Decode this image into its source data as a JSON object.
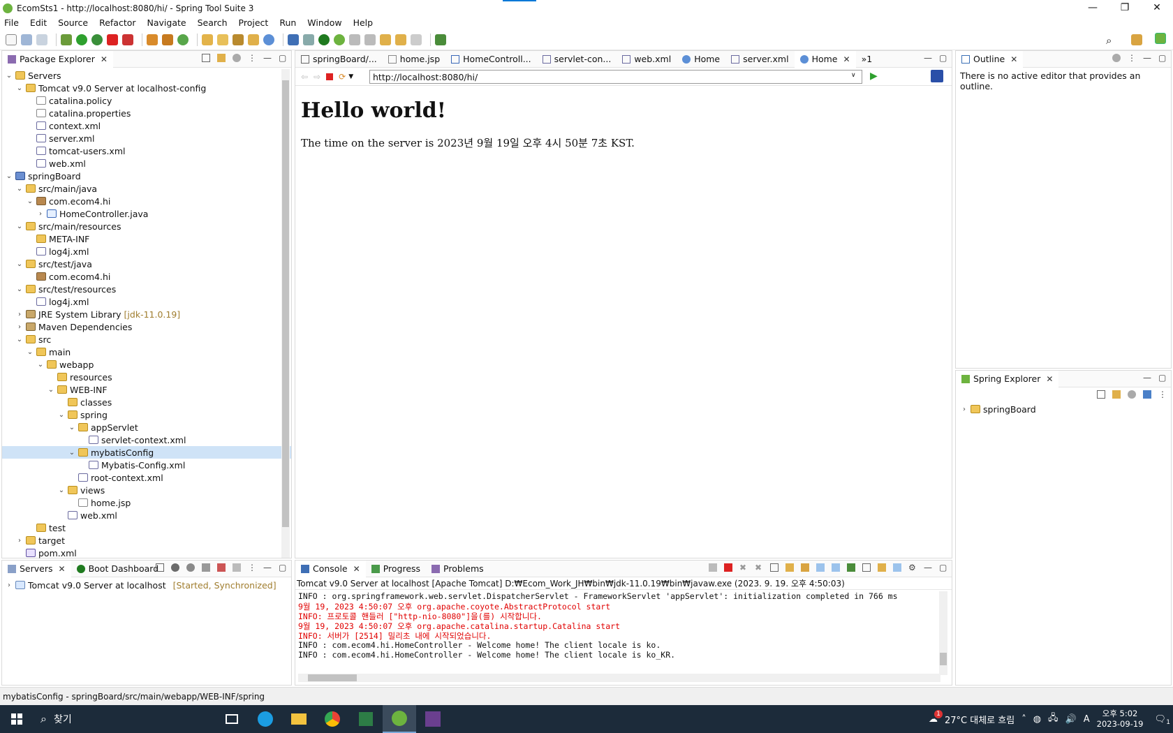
{
  "window": {
    "title": "EcomSts1 - http://localhost:8080/hi/ - Spring Tool Suite 3",
    "minimize": "—",
    "restore": "❐",
    "close": "✕"
  },
  "menu": [
    "File",
    "Edit",
    "Source",
    "Refactor",
    "Navigate",
    "Search",
    "Project",
    "Run",
    "Window",
    "Help"
  ],
  "package_explorer": {
    "tab_label": "Package Explorer",
    "tree": [
      {
        "label": "Servers",
        "indent": 0,
        "twisty": "v",
        "icon": "folder"
      },
      {
        "label": "Tomcat v9.0 Server at localhost-config",
        "indent": 1,
        "twisty": "v",
        "icon": "folder"
      },
      {
        "label": "catalina.policy",
        "indent": 2,
        "twisty": "",
        "icon": "file"
      },
      {
        "label": "catalina.properties",
        "indent": 2,
        "twisty": "",
        "icon": "file"
      },
      {
        "label": "context.xml",
        "indent": 2,
        "twisty": "",
        "icon": "xml"
      },
      {
        "label": "server.xml",
        "indent": 2,
        "twisty": "",
        "icon": "xml"
      },
      {
        "label": "tomcat-users.xml",
        "indent": 2,
        "twisty": "",
        "icon": "xml"
      },
      {
        "label": "web.xml",
        "indent": 2,
        "twisty": "",
        "icon": "xml"
      },
      {
        "label": "springBoard",
        "indent": 0,
        "twisty": "v",
        "icon": "proj"
      },
      {
        "label": "src/main/java",
        "indent": 1,
        "twisty": "v",
        "icon": "folder"
      },
      {
        "label": "com.ecom4.hi",
        "indent": 2,
        "twisty": "v",
        "icon": "pkg"
      },
      {
        "label": "HomeController.java",
        "indent": 3,
        "twisty": ">",
        "icon": "java"
      },
      {
        "label": "src/main/resources",
        "indent": 1,
        "twisty": "v",
        "icon": "folder"
      },
      {
        "label": "META-INF",
        "indent": 2,
        "twisty": "",
        "icon": "folder"
      },
      {
        "label": "log4j.xml",
        "indent": 2,
        "twisty": "",
        "icon": "xml"
      },
      {
        "label": "src/test/java",
        "indent": 1,
        "twisty": "v",
        "icon": "folder"
      },
      {
        "label": "com.ecom4.hi",
        "indent": 2,
        "twisty": "",
        "icon": "pkg"
      },
      {
        "label": "src/test/resources",
        "indent": 1,
        "twisty": "v",
        "icon": "folder"
      },
      {
        "label": "log4j.xml",
        "indent": 2,
        "twisty": "",
        "icon": "xml"
      },
      {
        "label": "JRE System Library",
        "indent": 1,
        "twisty": ">",
        "icon": "lib",
        "decoration": "[jdk-11.0.19]"
      },
      {
        "label": "Maven Dependencies",
        "indent": 1,
        "twisty": ">",
        "icon": "lib"
      },
      {
        "label": "src",
        "indent": 1,
        "twisty": "v",
        "icon": "folder"
      },
      {
        "label": "main",
        "indent": 2,
        "twisty": "v",
        "icon": "folder"
      },
      {
        "label": "webapp",
        "indent": 3,
        "twisty": "v",
        "icon": "folder"
      },
      {
        "label": "resources",
        "indent": 4,
        "twisty": "",
        "icon": "folder"
      },
      {
        "label": "WEB-INF",
        "indent": 4,
        "twisty": "v",
        "icon": "folder"
      },
      {
        "label": "classes",
        "indent": 5,
        "twisty": "",
        "icon": "folder"
      },
      {
        "label": "spring",
        "indent": 5,
        "twisty": "v",
        "icon": "folder"
      },
      {
        "label": "appServlet",
        "indent": 6,
        "twisty": "v",
        "icon": "folder"
      },
      {
        "label": "servlet-context.xml",
        "indent": 7,
        "twisty": "",
        "icon": "xml"
      },
      {
        "label": "mybatisConfig",
        "indent": 6,
        "twisty": "v",
        "icon": "folder",
        "selected": true
      },
      {
        "label": "Mybatis-Config.xml",
        "indent": 7,
        "twisty": "",
        "icon": "xml"
      },
      {
        "label": "root-context.xml",
        "indent": 6,
        "twisty": "",
        "icon": "xml"
      },
      {
        "label": "views",
        "indent": 5,
        "twisty": "v",
        "icon": "folder"
      },
      {
        "label": "home.jsp",
        "indent": 6,
        "twisty": "",
        "icon": "file"
      },
      {
        "label": "web.xml",
        "indent": 5,
        "twisty": "",
        "icon": "xml"
      },
      {
        "label": "test",
        "indent": 2,
        "twisty": "",
        "icon": "folder"
      },
      {
        "label": "target",
        "indent": 1,
        "twisty": ">",
        "icon": "folder"
      },
      {
        "label": "pom.xml",
        "indent": 1,
        "twisty": "",
        "icon": "pom"
      }
    ]
  },
  "editor_tabs": [
    {
      "label": "springBoard/...",
      "active": false
    },
    {
      "label": "home.jsp",
      "active": false
    },
    {
      "label": "HomeControll...",
      "active": false
    },
    {
      "label": "servlet-con...",
      "active": false
    },
    {
      "label": "web.xml",
      "active": false
    },
    {
      "label": "Home",
      "active": false
    },
    {
      "label": "server.xml",
      "active": false
    },
    {
      "label": "Home",
      "active": true
    }
  ],
  "editor_overflow": "»1",
  "browser": {
    "url": "http://localhost:8080/hi/",
    "heading": "Hello world!",
    "body_text": "The time on the server is 2023년 9월 19일 오후 4시 50분 7초 KST."
  },
  "outline": {
    "tab_label": "Outline",
    "message": "There is no active editor that provides an outline."
  },
  "spring_explorer": {
    "tab_label": "Spring Explorer",
    "items": [
      "springBoard"
    ]
  },
  "servers_view": {
    "tabs": [
      "Servers",
      "Boot Dashboard"
    ],
    "items": [
      {
        "label": "Tomcat v9.0 Server at localhost",
        "status": "[Started, Synchronized]"
      }
    ]
  },
  "console_view": {
    "tabs": [
      "Console",
      "Progress",
      "Problems"
    ],
    "header": "Tomcat v9.0 Server at localhost [Apache Tomcat] D:₩Ecom_Work_JH₩bin₩jdk-11.0.19₩bin₩javaw.exe  (2023. 9. 19. 오후 4:50:03)",
    "lines": [
      {
        "text": "INFO : org.springframework.web.servlet.DispatcherServlet - FrameworkServlet 'appServlet': initialization completed in 766 ms",
        "color": "black"
      },
      {
        "text": "9월 19, 2023 4:50:07 오후 org.apache.coyote.AbstractProtocol start",
        "color": "red"
      },
      {
        "text": "INFO: 프로토콜 핸들러 [\"http-nio-8080\"]을(를) 시작합니다.",
        "color": "red"
      },
      {
        "text": "9월 19, 2023 4:50:07 오후 org.apache.catalina.startup.Catalina start",
        "color": "red"
      },
      {
        "text": "INFO: 서버가 [2514] 밀리초 내에 시작되었습니다.",
        "color": "red"
      },
      {
        "text": "INFO : com.ecom4.hi.HomeController - Welcome home! The client locale is ko.",
        "color": "black"
      },
      {
        "text": "INFO : com.ecom4.hi.HomeController - Welcome home! The client locale is ko_KR.",
        "color": "black"
      }
    ]
  },
  "status_bar": {
    "text": "mybatisConfig - springBoard/src/main/webapp/WEB-INF/spring"
  },
  "taskbar": {
    "search_placeholder": "찾기",
    "weather": "27°C  대체로 흐림",
    "ime": "A",
    "time": "오후 5:02",
    "date": "2023-09-19",
    "notification_count": "1",
    "weather_badge": "1"
  },
  "colors": {
    "accent": "#0078d7",
    "spring_green": "#6db33f",
    "console_red": "#e00000",
    "selection": "#cfe3f7"
  }
}
